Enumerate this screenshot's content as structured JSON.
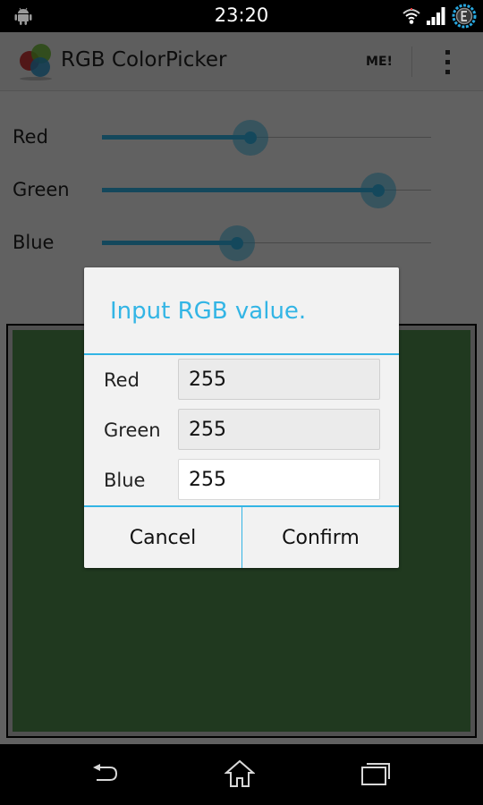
{
  "status_bar": {
    "time": "23:20",
    "icons": [
      "android-debug-icon",
      "wifi-icon",
      "signal-icon",
      "sync-icon"
    ]
  },
  "action_bar": {
    "title": "RGB ColorPicker",
    "logo": "rgb-circles-logo",
    "me_label": "ME!",
    "overflow_icon": "overflow-menu-icon"
  },
  "sliders": [
    {
      "label": "Red",
      "value_fraction": 0.45
    },
    {
      "label": "Green",
      "value_fraction": 0.84
    },
    {
      "label": "Blue",
      "value_fraction": 0.41
    }
  ],
  "colors": {
    "accent": "#33b5e5",
    "preview": "#52904f"
  },
  "dialog": {
    "title": "Input RGB value.",
    "fields": [
      {
        "label": "Red",
        "value": "255"
      },
      {
        "label": "Green",
        "value": "255"
      },
      {
        "label": "Blue",
        "value": "255"
      }
    ],
    "cancel_label": "Cancel",
    "confirm_label": "Confirm"
  },
  "nav_bar": {
    "icons": [
      "back-icon",
      "home-icon",
      "recents-icon"
    ]
  }
}
